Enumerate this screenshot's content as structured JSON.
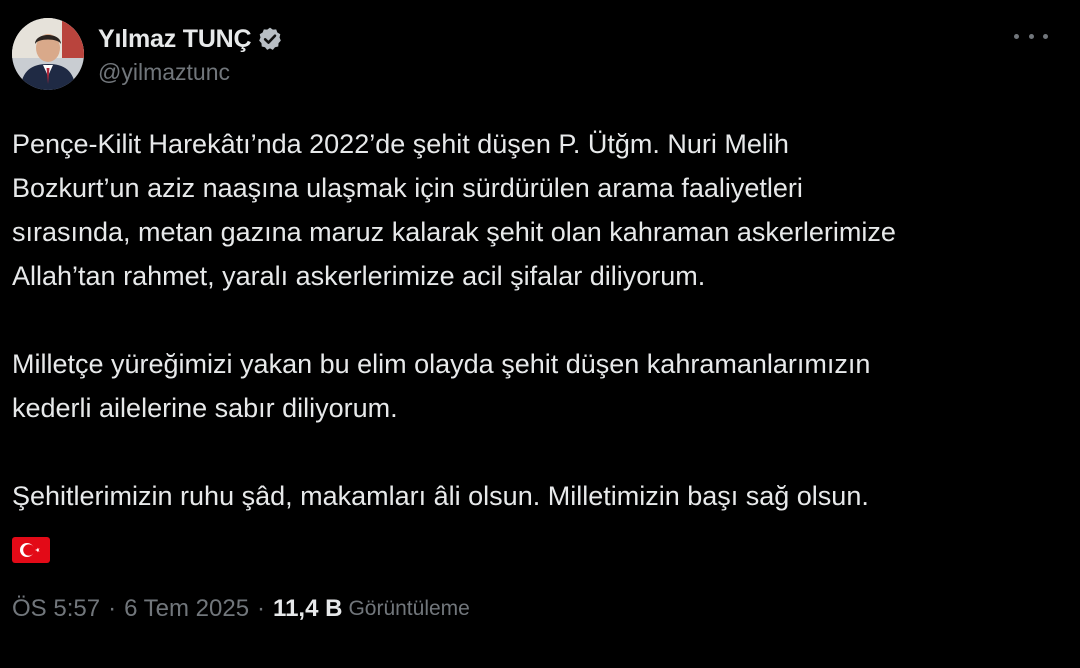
{
  "author": {
    "display_name": "Yılmaz TUNÇ",
    "handle": "@yilmaztunc",
    "verified": true,
    "verified_color": "#1d9bf0"
  },
  "tweet": {
    "paragraphs": [
      "Pençe-Kilit Harekâtı’nda 2022’de şehit düşen P. Ütğm. Nuri Melih\nBozkurt’un aziz naaşına ulaşmak için sürdürülen arama faaliyetleri\nsırasında, metan gazına maruz kalarak şehit olan kahraman askerlerimize\nAllah’tan rahmet, yaralı askerlerimize acil şifalar diliyorum.",
      "Milletçe yüreğimizi yakan bu elim olayda şehit düşen kahramanlarımızın\nkederli ailelerine sabır diliyorum.",
      "Şehitlerimizin ruhu şâd, makamları âli olsun. Milletimizin başı sağ olsun."
    ],
    "emoji": "turkey-flag-icon"
  },
  "meta": {
    "time": "ÖS 5:57",
    "separator": "·",
    "date": "6 Tem 2025",
    "views_count": "11,4 B",
    "views_label": "Görüntüleme"
  },
  "colors": {
    "background": "#000000",
    "text_primary": "#e7e9ea",
    "text_secondary": "#71767b",
    "flag_red": "#e30a17"
  },
  "icons": {
    "more": "more-horizontal-icon",
    "verified": "verified-badge-icon",
    "flag": "turkey-flag-icon"
  }
}
